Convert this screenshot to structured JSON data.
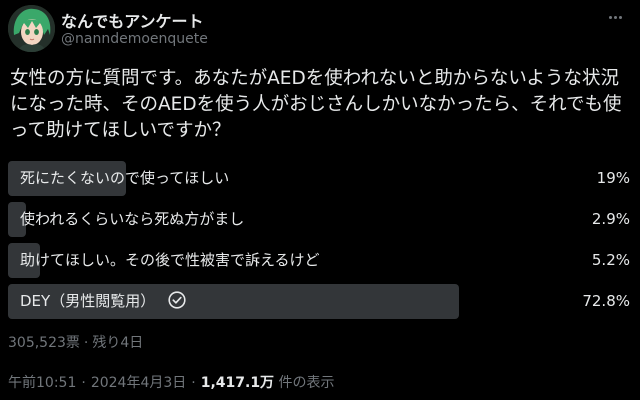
{
  "author": {
    "display_name": "なんでもアンケート",
    "handle": "@nanndemoenquete",
    "avatar_icon": "anime-character-avatar-icon"
  },
  "menu": {
    "more_icon": "more-horizontal-icon"
  },
  "tweet": {
    "text": "女性の方に質問です。あなたがAEDを使われないと助からないような状況\nになった時、そのAEDを使う人がおじさんしかいなかったら、それでも使\nって助けてほしいですか？"
  },
  "poll": {
    "options": [
      {
        "label": "死にたくないので使ってほしい",
        "percent_text": "19%",
        "value": 19.0,
        "winner": false
      },
      {
        "label": "使われるくらいなら死ぬ方がまし",
        "percent_text": "2.9%",
        "value": 2.9,
        "winner": false
      },
      {
        "label": "助けてほしい。その後で性被害で訴えるけど",
        "percent_text": "5.2%",
        "value": 5.2,
        "winner": false
      },
      {
        "label": "DEY（男性閲覧用）",
        "percent_text": "72.8%",
        "value": 72.8,
        "winner": true
      }
    ],
    "check_icon": "check-circle-icon",
    "votes": "305,523票",
    "remaining": "残り4日",
    "meta_separator": "·"
  },
  "footer": {
    "time": "午前10:51",
    "date": "2024年4月3日",
    "views_count": "1,417.1万",
    "views_label": "件の表示",
    "separator": "·"
  },
  "colors": {
    "background": "#000000",
    "text_primary": "#e7e9ea",
    "text_secondary": "#71767b",
    "poll_bar": "#333639"
  }
}
